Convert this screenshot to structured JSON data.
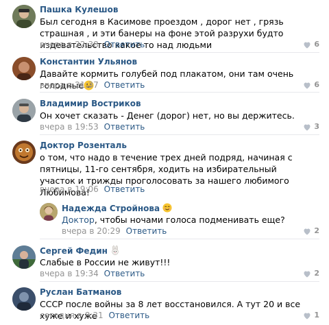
{
  "comments": [
    {
      "author": "Пашка Кулешов",
      "text": "Был сегодня в Касимове проездом , дорог нет , грязь страшная , и эти банеры на фоне этой разрухи будто издевательство какое то над людьми",
      "time": "вчера в 22:38",
      "reply": "Ответить",
      "likes": "6"
    },
    {
      "author": "Константин Ульянов",
      "text": "Давайте кормить голубей под плакатом, они там очень голодные",
      "emoji": "smile-emoji",
      "time": "вчера в 21:37",
      "reply": "Ответить",
      "likes": "6"
    },
    {
      "author": "Владимир Востриков",
      "text": "Он хочет сказать - Денег (дорог) нет, но вы держитесь.",
      "time": "вчера в 19:53",
      "reply": "Ответить",
      "likes": "3"
    },
    {
      "author": "Доктор Розенталь",
      "text": "о том, что надо в течение трех дней подряд, начиная с пятницы, 11-го сентября, ходить на избирательный участок и трижды проголосовать за нашего любимого Любимова!",
      "time": "вчера в 19:06",
      "reply": "Ответить",
      "likes": ""
    },
    {
      "author": "Надежда Стройнова",
      "author_emoji": "smile-emoji",
      "mention": "Доктор",
      "text": ", чтобы ночами голоса подменивать еще?",
      "time": "вчера в 20:29",
      "reply": "Ответить",
      "likes": "2"
    },
    {
      "author": "Сергей Федин",
      "author_emoji": "rabbit-emoji",
      "text": "Слабые в России не живут!!!",
      "time": "вчера в 19:34",
      "reply": "Ответить",
      "likes": "2"
    },
    {
      "author": "Руслан Батманов",
      "text": "СССР после войны за 8 лет восстановился. А тут 20 и все хуже и хуже",
      "time": "сегодня в 8:31",
      "reply": "Ответить",
      "likes": "1"
    }
  ],
  "colors": {
    "link": "#2a5885",
    "meta": "#939393",
    "separator": "#e7e8ec"
  }
}
